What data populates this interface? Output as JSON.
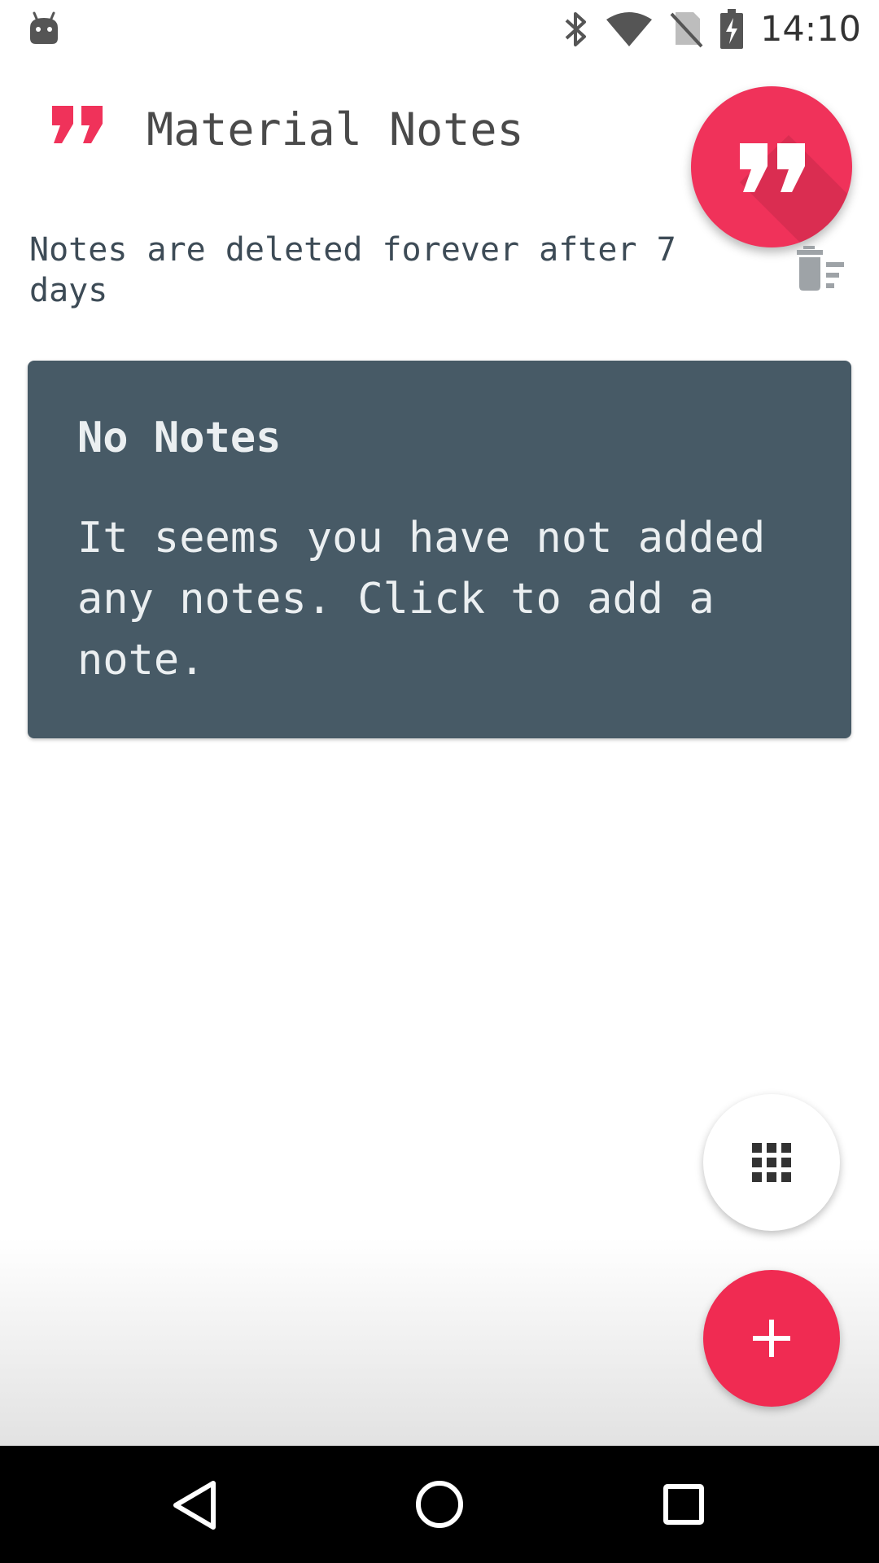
{
  "status_bar": {
    "time": "14:10",
    "icons": [
      "android-debug-icon",
      "bluetooth-icon",
      "wifi-icon",
      "no-sim-icon",
      "battery-charging-icon"
    ]
  },
  "header": {
    "title": "Material Notes",
    "logo_icon": "quote-icon"
  },
  "info": {
    "text": "Notes are deleted forever after 7 days",
    "action_icon": "trash-sort-icon"
  },
  "empty_card": {
    "title": "No Notes",
    "body": "It seems you have not added any notes. Click to add a note."
  },
  "fabs": {
    "main_icon": "quote-icon",
    "grid_icon": "grid-icon",
    "add_icon": "plus-icon"
  },
  "nav_bar": {
    "icons": [
      "back-icon",
      "home-icon",
      "recents-icon"
    ]
  },
  "colors": {
    "accent": "#f0325a",
    "card": "#475a66",
    "card_text": "#ebeff1",
    "info_text": "#3d4b56",
    "icon_gray": "#9ea3a7"
  }
}
